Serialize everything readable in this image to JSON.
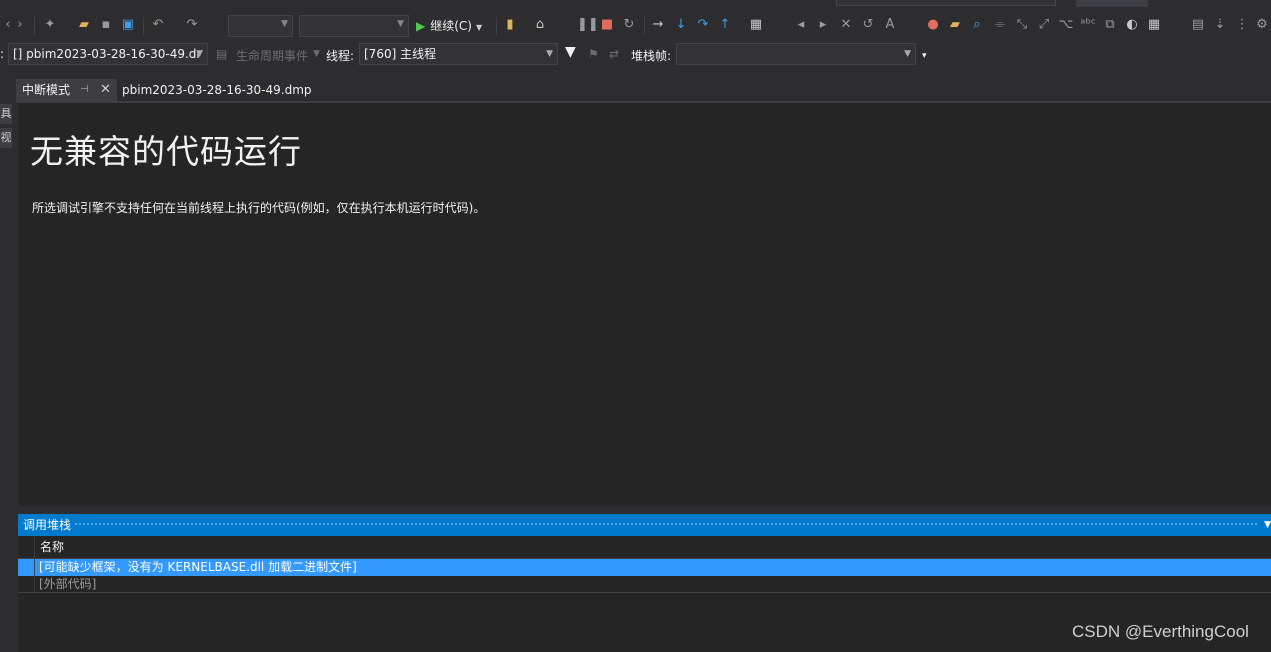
{
  "toolbar": {
    "continue_label": "继续(C)"
  },
  "debug_location": {
    "process_value": "[] pbim2023-03-28-16-30-49.dr",
    "lifecycle_label": "生命周期事件",
    "thread_label": "线程:",
    "thread_value": "[760] 主线程",
    "stackframe_label": "堆栈帧:",
    "stackframe_value": ""
  },
  "left_strip": {
    "tab1": "具",
    "tab2": "视"
  },
  "tabs": [
    {
      "label": "中断模式",
      "active": true
    },
    {
      "label": "pbim2023-03-28-16-30-49.dmp",
      "active": false
    }
  ],
  "document": {
    "heading": "无兼容的代码运行",
    "description": "所选调试引擎不支持任何在当前线程上执行的代码(例如，仅在执行本机运行时代码)。"
  },
  "call_stack": {
    "title": "调用堆栈",
    "column_name": "名称",
    "rows": [
      "[可能缺少框架，没有为 KERNELBASE.dll 加载二进制文件]",
      "[外部代码]"
    ]
  },
  "watermark": "CSDN @EverthingCool",
  "colors": {
    "accent": "#007acc",
    "selection": "#3399ff",
    "background": "#252526",
    "chrome": "#2d2d30"
  }
}
